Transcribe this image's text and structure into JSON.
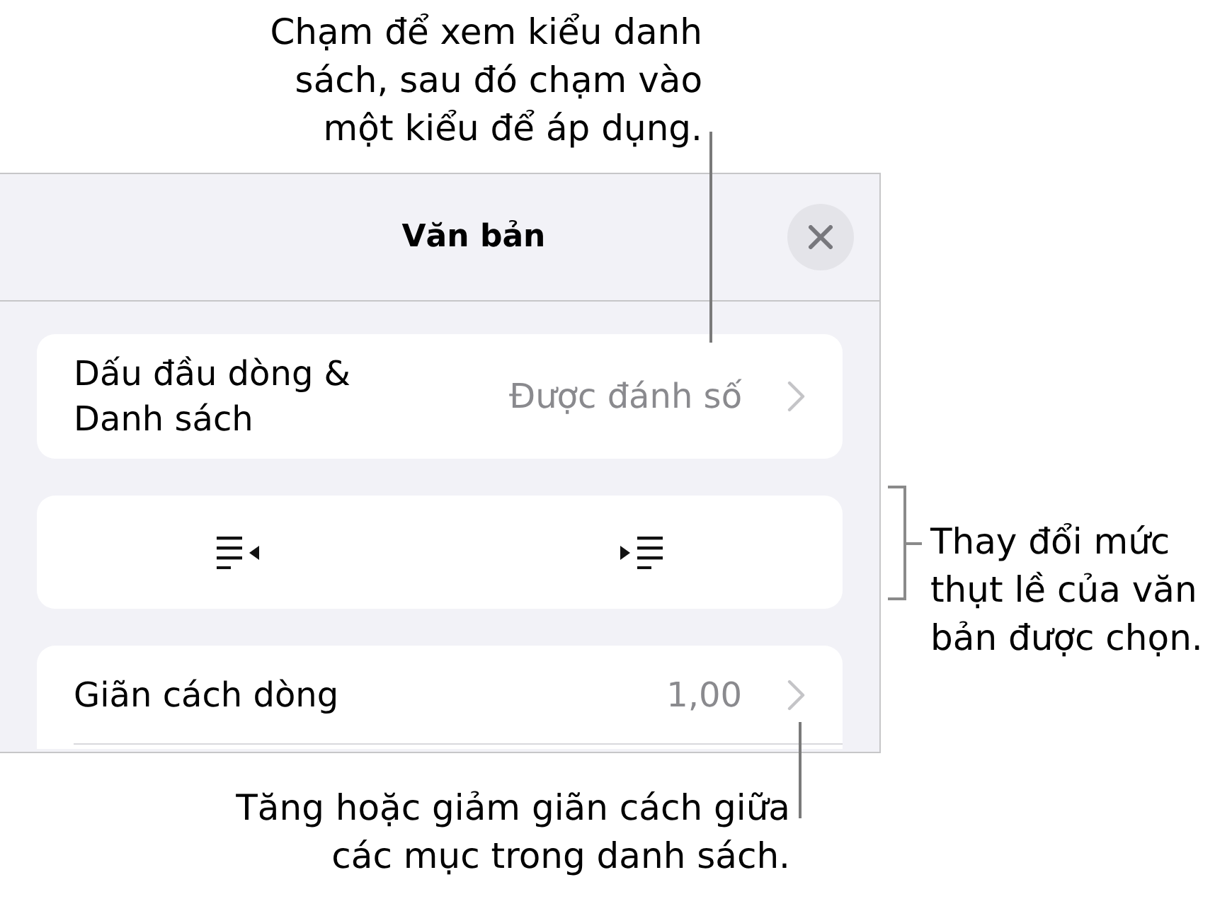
{
  "panel": {
    "title": "Văn bản",
    "sections": [
      {
        "continues_below": false,
        "rows": [
          {
            "kind": "disclosure",
            "label": "Dấu đầu dòng & Danh sách",
            "value": "Được đánh số"
          }
        ]
      },
      {
        "continues_below": false,
        "rows": [
          {
            "kind": "indent_buttons"
          }
        ]
      },
      {
        "continues_below": true,
        "rows": [
          {
            "kind": "disclosure",
            "label": "Giãn cách dòng",
            "value": "1,00"
          }
        ]
      }
    ]
  },
  "callouts": [
    {
      "kind": "line",
      "text": "Chạm để xem kiểu danh\nsách, sau đó chạm vào\nmột kiểu để áp dụng."
    },
    {
      "kind": "bracket",
      "text": "Thay đổi mức\nthụt lề của văn\nbản được chọn."
    },
    {
      "kind": "line",
      "text": "Tăng hoặc giảm giãn cách giữa\ncác mục trong danh sách."
    }
  ]
}
